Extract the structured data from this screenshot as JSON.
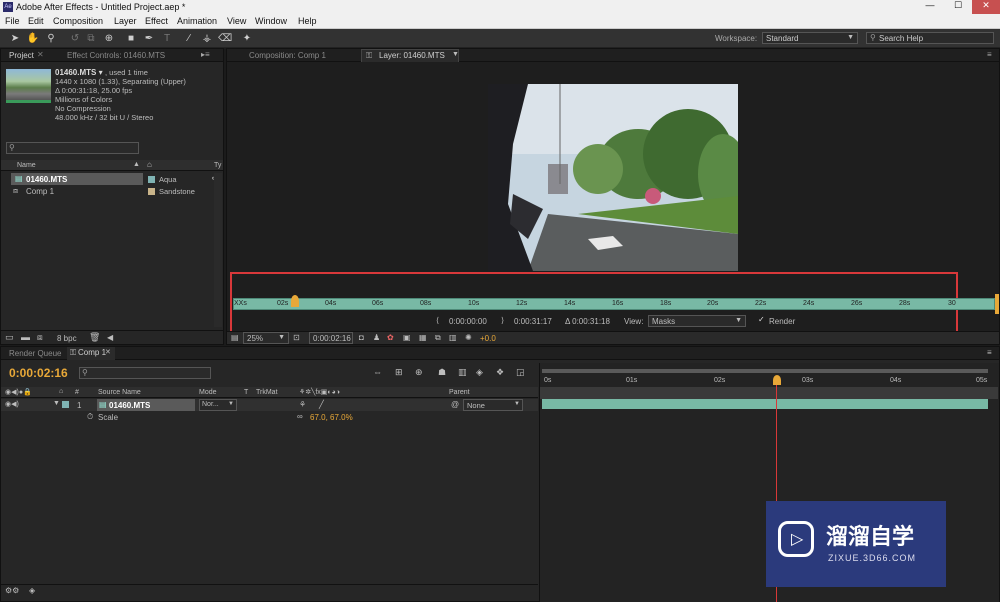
{
  "window": {
    "title": "Adobe After Effects - Untitled Project.aep *",
    "min": "—",
    "max": "☐",
    "close": "✕"
  },
  "menu": [
    "File",
    "Edit",
    "Composition",
    "Layer",
    "Effect",
    "Animation",
    "View",
    "Window",
    "Help"
  ],
  "toolbar": {
    "workspace_label": "Workspace:",
    "workspace_value": "Standard",
    "search_placeholder": "Search Help"
  },
  "project_panel": {
    "tab_project": "Project",
    "tab_effect_controls": "Effect Controls: 01460.MTS",
    "item_name": "01460.MTS ▾",
    "item_used": ", used 1 time",
    "info_lines": [
      "1440 x 1080 (1.33), Separating (Upper)",
      "Δ 0:00:31:18, 25.00 fps",
      "Millions of Colors",
      "No Compression",
      "48.000 kHz / 32 bit U / Stereo"
    ],
    "col_name": "Name",
    "col_type": "Ty",
    "items": [
      {
        "name": "01460.MTS",
        "label": "Aqua",
        "color": "#7fb3b3"
      },
      {
        "name": "Comp 1",
        "label": "Sandstone",
        "color": "#c9b48a"
      }
    ],
    "bpc": "8 bpc"
  },
  "viewer": {
    "tab_comp": "Composition: Comp 1",
    "tab_layer": "Layer: 01460.MTS",
    "ruler_ticks": [
      "XXs",
      "02s",
      "04s",
      "06s",
      "08s",
      "10s",
      "12s",
      "14s",
      "16s",
      "18s",
      "20s",
      "22s",
      "24s",
      "26s",
      "28s",
      "30"
    ],
    "in_time": "0:00:00:00",
    "out_time": "0:00:31:17",
    "duration": "Δ 0:00:31:18",
    "view_label": "View:",
    "view_value": "Masks",
    "render_label": "Render",
    "zoom": "25%",
    "current_time": "0:00:02:16",
    "exposure": "+0.0"
  },
  "timeline": {
    "tab_render_queue": "Render Queue",
    "tab_comp": "Comp 1",
    "current_time": "0:00:02:16",
    "col_hash": "#",
    "col_source": "Source Name",
    "col_mode": "Mode",
    "col_t": "T",
    "col_trkmat": "TrkMat",
    "col_parent": "Parent",
    "layer_index": "1",
    "layer_name": "01460.MTS",
    "layer_mode": "Nor...",
    "layer_parent": "None",
    "prop_name": "Scale",
    "prop_value": "67.0, 67.0%",
    "ticks": [
      "0s",
      "01s",
      "02s",
      "03s",
      "04s",
      "05s"
    ]
  },
  "watermark": {
    "brand": "溜溜自学",
    "url": "ZIXUE.3D66.COM"
  }
}
